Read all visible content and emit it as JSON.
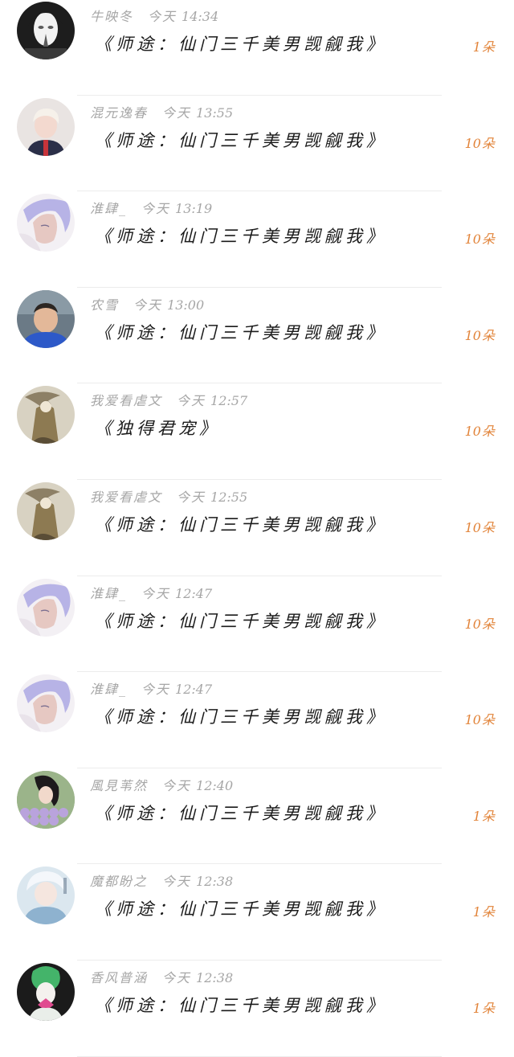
{
  "gifts": [
    {
      "user": "牛映冬",
      "day": "今天",
      "time": "14:34",
      "book": "《师途：仙门三千美男觊觎我》",
      "count": "1",
      "unit": "朵",
      "avatar": "dark-mask-avatar",
      "colors": [
        "#1d1d1d",
        "#f2f2f2",
        "#5b5b5b"
      ]
    },
    {
      "user": "混元逸春",
      "day": "今天",
      "time": "13:55",
      "book": "《师途：仙门三千美男觊觎我》",
      "count": "10",
      "unit": "朵",
      "avatar": "blonde-boy-avatar",
      "colors": [
        "#e9e4e2",
        "#f3d9cf",
        "#2b2f48"
      ]
    },
    {
      "user": "淮肆_",
      "day": "今天",
      "time": "13:19",
      "book": "《师途：仙门三千美男觊觎我》",
      "count": "10",
      "unit": "朵",
      "avatar": "anime-lavender-avatar",
      "colors": [
        "#f3f0f4",
        "#b7b3e6",
        "#e6c8c2"
      ]
    },
    {
      "user": "农雪",
      "day": "今天",
      "time": "13:00",
      "book": "《师途：仙门三千美男觊觎我》",
      "count": "10",
      "unit": "朵",
      "avatar": "child-photo-avatar",
      "colors": [
        "#6b7a86",
        "#e3b899",
        "#2d59c8"
      ]
    },
    {
      "user": "我爱看虐文",
      "day": "今天",
      "time": "12:57",
      "book": "《独得君宠》",
      "count": "10",
      "unit": "朵",
      "avatar": "ink-painting-avatar",
      "colors": [
        "#d8d2c2",
        "#8d7a52",
        "#3c3426"
      ]
    },
    {
      "user": "我爱看虐文",
      "day": "今天",
      "time": "12:55",
      "book": "《师途：仙门三千美男觊觎我》",
      "count": "10",
      "unit": "朵",
      "avatar": "ink-painting-avatar",
      "colors": [
        "#d8d2c2",
        "#8d7a52",
        "#3c3426"
      ]
    },
    {
      "user": "淮肆_",
      "day": "今天",
      "time": "12:47",
      "book": "《师途：仙门三千美男觊觎我》",
      "count": "10",
      "unit": "朵",
      "avatar": "anime-lavender-avatar",
      "colors": [
        "#f3f0f4",
        "#b7b3e6",
        "#e6c8c2"
      ]
    },
    {
      "user": "淮肆_",
      "day": "今天",
      "time": "12:47",
      "book": "《师途：仙门三千美男觊觎我》",
      "count": "10",
      "unit": "朵",
      "avatar": "anime-lavender-avatar",
      "colors": [
        "#f3f0f4",
        "#b7b3e6",
        "#e6c8c2"
      ]
    },
    {
      "user": "風見苇然",
      "day": "今天",
      "time": "12:40",
      "book": "《师途：仙门三千美男觊觎我》",
      "count": "1",
      "unit": "朵",
      "avatar": "flowers-girl-avatar",
      "colors": [
        "#9bb48a",
        "#1d1a1c",
        "#b9a3dc"
      ]
    },
    {
      "user": "魔都盼之",
      "day": "今天",
      "time": "12:38",
      "book": "《师途：仙门三千美男觊觎我》",
      "count": "1",
      "unit": "朵",
      "avatar": "blue-anime-avatar",
      "colors": [
        "#dbe7ef",
        "#8eb2cf",
        "#f2f4f7"
      ]
    },
    {
      "user": "香风普涵",
      "day": "今天",
      "time": "12:38",
      "book": "《师途：仙门三千美男觊觎我》",
      "count": "1",
      "unit": "朵",
      "avatar": "green-sprite-avatar",
      "colors": [
        "#1b1b1b",
        "#44b46a",
        "#e04b8f"
      ]
    }
  ]
}
